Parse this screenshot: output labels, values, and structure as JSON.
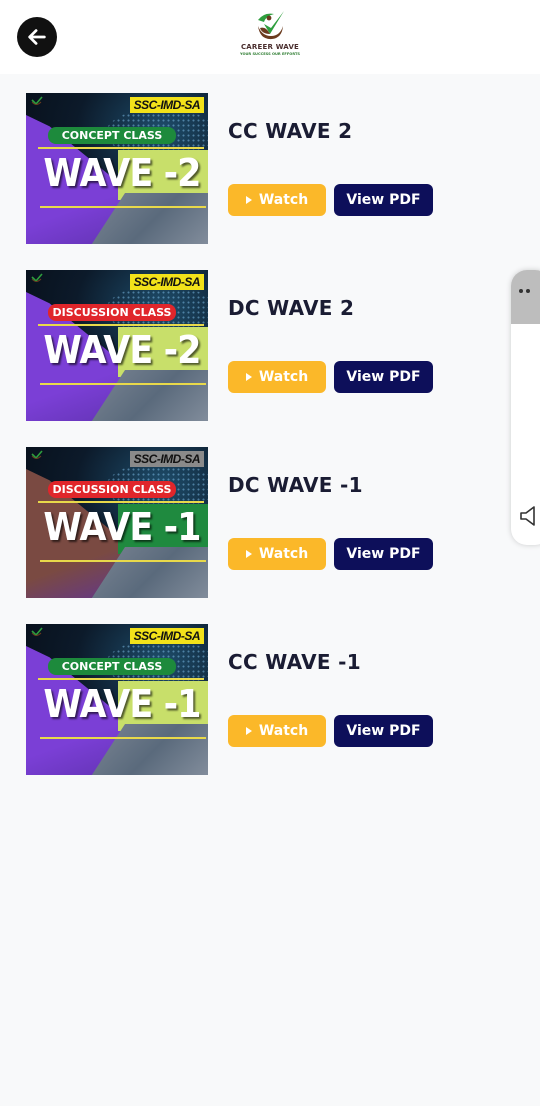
{
  "header": {
    "back_icon": "arrow-left-icon",
    "logo": {
      "title": "CAREER WAVE",
      "tagline": "YOUR SUCCESS OUR EFFORTS"
    }
  },
  "colors": {
    "watch_button": "#fbb829",
    "pdf_button": "#0d0f5a",
    "title_text": "#1a1c33",
    "background": "#f8f9fa"
  },
  "items": [
    {
      "title": "CC WAVE 2",
      "watch_label": "Watch",
      "pdf_label": "View PDF",
      "thumbnail": {
        "tag": "SSC-IMD-SA",
        "class_label": "CONCEPT CLASS",
        "wave_label": "WAVE -2",
        "tag_bg": "#f2e21a",
        "pill_bg": "#1d8a3c",
        "left_shape": "#7b3fd6",
        "right_panel": "#c8df6a"
      }
    },
    {
      "title": "DC WAVE 2",
      "watch_label": "Watch",
      "pdf_label": "View PDF",
      "thumbnail": {
        "tag": "SSC-IMD-SA",
        "class_label": "DISCUSSION CLASS",
        "wave_label": "WAVE -2",
        "tag_bg": "#f2e21a",
        "pill_bg": "#e0262b",
        "left_shape": "#7b3fd6",
        "right_panel": "#c8df6a"
      }
    },
    {
      "title": "DC WAVE -1",
      "watch_label": "Watch",
      "pdf_label": "View PDF",
      "thumbnail": {
        "tag": "SSC-IMD-SA",
        "class_label": "DISCUSSION CLASS",
        "wave_label": "WAVE -1",
        "tag_bg": "#8a8a8a",
        "pill_bg": "#e0262b",
        "left_shape": "#7a4a42",
        "right_panel": "#1f8a3f"
      }
    },
    {
      "title": "CC WAVE -1",
      "watch_label": "Watch",
      "pdf_label": "View PDF",
      "thumbnail": {
        "tag": "SSC-IMD-SA",
        "class_label": "CONCEPT CLASS",
        "wave_label": "WAVE -1",
        "tag_bg": "#f2e21a",
        "pill_bg": "#1d8a3c",
        "left_shape": "#7b3fd6",
        "right_panel": "#c8df6a"
      }
    }
  ],
  "edge_panel": {
    "handle_icon": "drag-handle-icon",
    "volume_icon": "volume-icon"
  }
}
